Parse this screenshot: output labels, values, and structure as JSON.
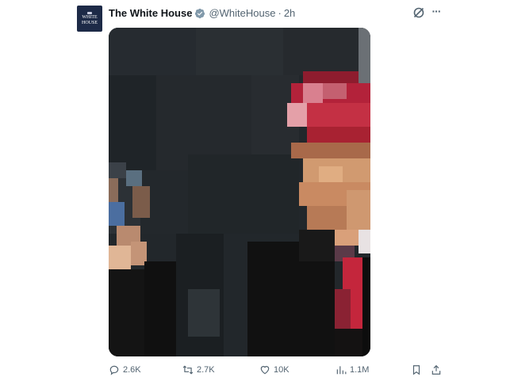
{
  "post": {
    "author_name": "The White House",
    "avatar_text_line1": "WHITE",
    "avatar_text_line2": "HOUSE",
    "handle": "@WhiteHouse",
    "separator": "·",
    "time": "2h",
    "more_label": "···"
  },
  "media": {
    "description": "pixelated photo",
    "colors": {
      "background": "#22272b",
      "cap_red": "#b3223a",
      "cap_pink": "#d9808f",
      "skin": "#d19a70",
      "suit_dark": "#111111",
      "tie_red": "#c4263c",
      "shirt_white": "#e8e2e3"
    }
  },
  "actions": {
    "replies": "2.6K",
    "reposts": "2.7K",
    "likes": "10K",
    "views": "1.1M"
  },
  "colors": {
    "text_primary": "#0f1419",
    "text_secondary": "#536471",
    "verified_gray": "#829aab",
    "avatar_bg": "#1d2a47"
  }
}
